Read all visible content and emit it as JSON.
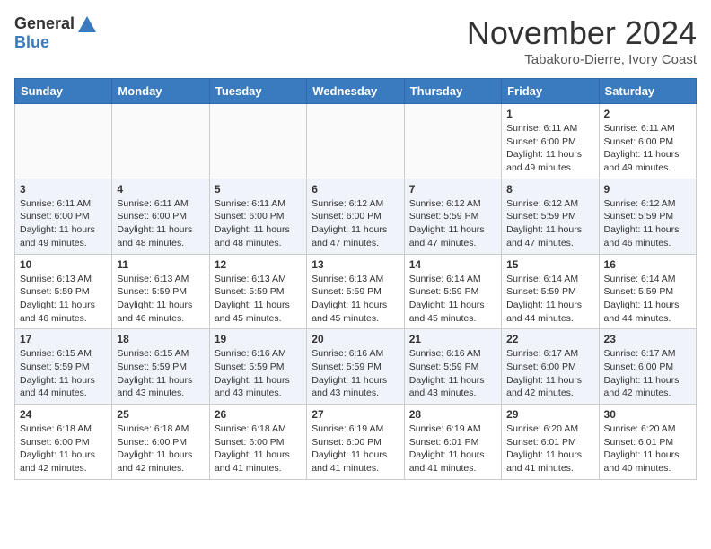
{
  "header": {
    "logo_general": "General",
    "logo_blue": "Blue",
    "month_title": "November 2024",
    "subtitle": "Tabakoro-Dierre, Ivory Coast"
  },
  "days_of_week": [
    "Sunday",
    "Monday",
    "Tuesday",
    "Wednesday",
    "Thursday",
    "Friday",
    "Saturday"
  ],
  "weeks": [
    {
      "cells": [
        {
          "day": null
        },
        {
          "day": null
        },
        {
          "day": null
        },
        {
          "day": null
        },
        {
          "day": null
        },
        {
          "day": 1,
          "sunrise": "Sunrise: 6:11 AM",
          "sunset": "Sunset: 6:00 PM",
          "daylight": "Daylight: 11 hours and 49 minutes."
        },
        {
          "day": 2,
          "sunrise": "Sunrise: 6:11 AM",
          "sunset": "Sunset: 6:00 PM",
          "daylight": "Daylight: 11 hours and 49 minutes."
        }
      ]
    },
    {
      "cells": [
        {
          "day": 3,
          "sunrise": "Sunrise: 6:11 AM",
          "sunset": "Sunset: 6:00 PM",
          "daylight": "Daylight: 11 hours and 49 minutes."
        },
        {
          "day": 4,
          "sunrise": "Sunrise: 6:11 AM",
          "sunset": "Sunset: 6:00 PM",
          "daylight": "Daylight: 11 hours and 48 minutes."
        },
        {
          "day": 5,
          "sunrise": "Sunrise: 6:11 AM",
          "sunset": "Sunset: 6:00 PM",
          "daylight": "Daylight: 11 hours and 48 minutes."
        },
        {
          "day": 6,
          "sunrise": "Sunrise: 6:12 AM",
          "sunset": "Sunset: 6:00 PM",
          "daylight": "Daylight: 11 hours and 47 minutes."
        },
        {
          "day": 7,
          "sunrise": "Sunrise: 6:12 AM",
          "sunset": "Sunset: 5:59 PM",
          "daylight": "Daylight: 11 hours and 47 minutes."
        },
        {
          "day": 8,
          "sunrise": "Sunrise: 6:12 AM",
          "sunset": "Sunset: 5:59 PM",
          "daylight": "Daylight: 11 hours and 47 minutes."
        },
        {
          "day": 9,
          "sunrise": "Sunrise: 6:12 AM",
          "sunset": "Sunset: 5:59 PM",
          "daylight": "Daylight: 11 hours and 46 minutes."
        }
      ]
    },
    {
      "cells": [
        {
          "day": 10,
          "sunrise": "Sunrise: 6:13 AM",
          "sunset": "Sunset: 5:59 PM",
          "daylight": "Daylight: 11 hours and 46 minutes."
        },
        {
          "day": 11,
          "sunrise": "Sunrise: 6:13 AM",
          "sunset": "Sunset: 5:59 PM",
          "daylight": "Daylight: 11 hours and 46 minutes."
        },
        {
          "day": 12,
          "sunrise": "Sunrise: 6:13 AM",
          "sunset": "Sunset: 5:59 PM",
          "daylight": "Daylight: 11 hours and 45 minutes."
        },
        {
          "day": 13,
          "sunrise": "Sunrise: 6:13 AM",
          "sunset": "Sunset: 5:59 PM",
          "daylight": "Daylight: 11 hours and 45 minutes."
        },
        {
          "day": 14,
          "sunrise": "Sunrise: 6:14 AM",
          "sunset": "Sunset: 5:59 PM",
          "daylight": "Daylight: 11 hours and 45 minutes."
        },
        {
          "day": 15,
          "sunrise": "Sunrise: 6:14 AM",
          "sunset": "Sunset: 5:59 PM",
          "daylight": "Daylight: 11 hours and 44 minutes."
        },
        {
          "day": 16,
          "sunrise": "Sunrise: 6:14 AM",
          "sunset": "Sunset: 5:59 PM",
          "daylight": "Daylight: 11 hours and 44 minutes."
        }
      ]
    },
    {
      "cells": [
        {
          "day": 17,
          "sunrise": "Sunrise: 6:15 AM",
          "sunset": "Sunset: 5:59 PM",
          "daylight": "Daylight: 11 hours and 44 minutes."
        },
        {
          "day": 18,
          "sunrise": "Sunrise: 6:15 AM",
          "sunset": "Sunset: 5:59 PM",
          "daylight": "Daylight: 11 hours and 43 minutes."
        },
        {
          "day": 19,
          "sunrise": "Sunrise: 6:16 AM",
          "sunset": "Sunset: 5:59 PM",
          "daylight": "Daylight: 11 hours and 43 minutes."
        },
        {
          "day": 20,
          "sunrise": "Sunrise: 6:16 AM",
          "sunset": "Sunset: 5:59 PM",
          "daylight": "Daylight: 11 hours and 43 minutes."
        },
        {
          "day": 21,
          "sunrise": "Sunrise: 6:16 AM",
          "sunset": "Sunset: 5:59 PM",
          "daylight": "Daylight: 11 hours and 43 minutes."
        },
        {
          "day": 22,
          "sunrise": "Sunrise: 6:17 AM",
          "sunset": "Sunset: 6:00 PM",
          "daylight": "Daylight: 11 hours and 42 minutes."
        },
        {
          "day": 23,
          "sunrise": "Sunrise: 6:17 AM",
          "sunset": "Sunset: 6:00 PM",
          "daylight": "Daylight: 11 hours and 42 minutes."
        }
      ]
    },
    {
      "cells": [
        {
          "day": 24,
          "sunrise": "Sunrise: 6:18 AM",
          "sunset": "Sunset: 6:00 PM",
          "daylight": "Daylight: 11 hours and 42 minutes."
        },
        {
          "day": 25,
          "sunrise": "Sunrise: 6:18 AM",
          "sunset": "Sunset: 6:00 PM",
          "daylight": "Daylight: 11 hours and 42 minutes."
        },
        {
          "day": 26,
          "sunrise": "Sunrise: 6:18 AM",
          "sunset": "Sunset: 6:00 PM",
          "daylight": "Daylight: 11 hours and 41 minutes."
        },
        {
          "day": 27,
          "sunrise": "Sunrise: 6:19 AM",
          "sunset": "Sunset: 6:00 PM",
          "daylight": "Daylight: 11 hours and 41 minutes."
        },
        {
          "day": 28,
          "sunrise": "Sunrise: 6:19 AM",
          "sunset": "Sunset: 6:01 PM",
          "daylight": "Daylight: 11 hours and 41 minutes."
        },
        {
          "day": 29,
          "sunrise": "Sunrise: 6:20 AM",
          "sunset": "Sunset: 6:01 PM",
          "daylight": "Daylight: 11 hours and 41 minutes."
        },
        {
          "day": 30,
          "sunrise": "Sunrise: 6:20 AM",
          "sunset": "Sunset: 6:01 PM",
          "daylight": "Daylight: 11 hours and 40 minutes."
        }
      ]
    }
  ]
}
